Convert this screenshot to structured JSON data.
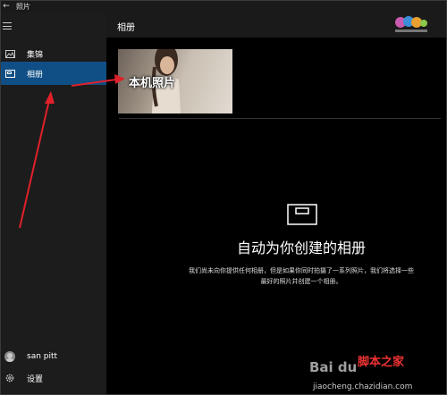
{
  "titlebar": {
    "app_title": "照片"
  },
  "sidebar": {
    "items": [
      {
        "label": "集锦",
        "icon": "collection-icon"
      },
      {
        "label": "相册",
        "icon": "album-icon"
      }
    ],
    "user": {
      "name": "san pitt"
    },
    "settings_label": "设置"
  },
  "main": {
    "title": "相册",
    "album": {
      "label": "本机照片"
    },
    "empty": {
      "title": "自动为你创建的相册",
      "desc_line1": "我们尚未向你提供任何相册，但是如果你同时拍摄了一系列照片，我们将选择一些",
      "desc_line2": "最好的照片并创建一个相册。"
    }
  },
  "watermark": {
    "baidu": "Bai du",
    "site": "脚本之家",
    "url": "jiaocheng.chazidian.com"
  },
  "colors": {
    "accent": "#0f4f85",
    "arrow": "#e0202a"
  }
}
